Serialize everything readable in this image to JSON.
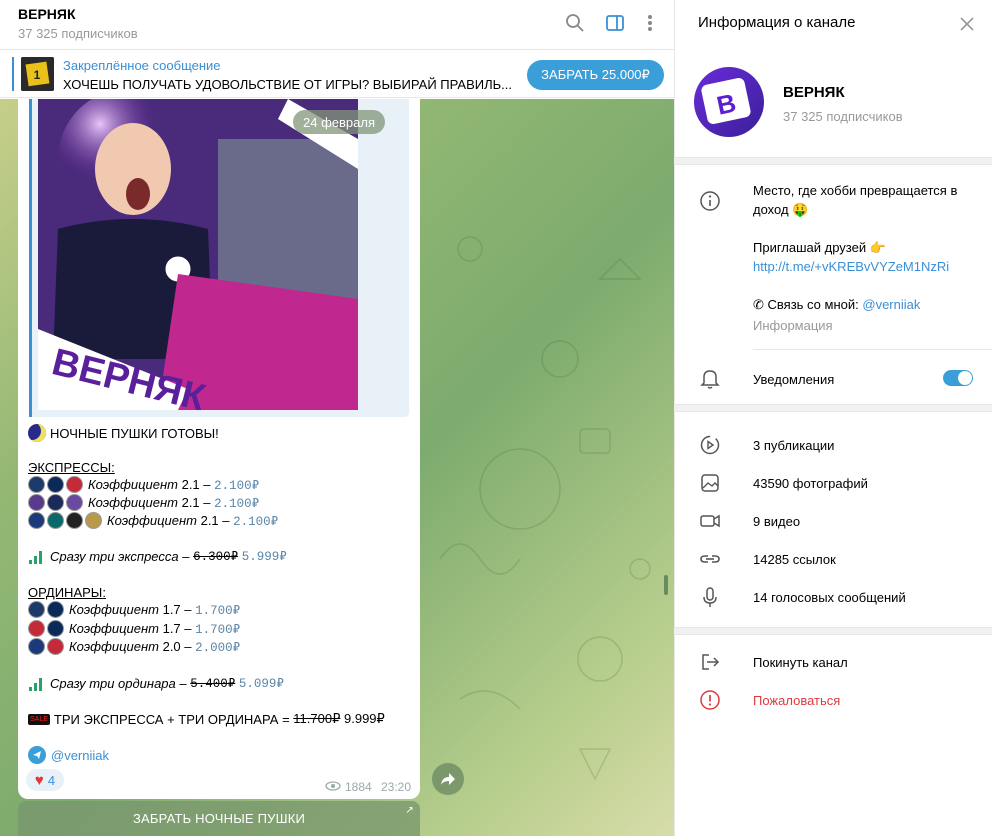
{
  "header": {
    "title": "ВЕРНЯК",
    "subscribers": "37 325 подписчиков"
  },
  "pinned": {
    "label": "Закреплённое сообщение",
    "text": "ХОЧЕШЬ ПОЛУЧАТЬ УДОВОЛЬСТВИЕ ОТ ИГРЫ? ВЫБИРАЙ ПРАВИЛЬ...",
    "button_label": "ЗАБРАТЬ 25.000₽"
  },
  "message": {
    "date_pill": "24 февраля",
    "photo_caption": "ВЕРНЯК",
    "headline": "НОЧНЫЕ ПУШКИ ГОТОВЫ!",
    "express_header": "ЭКСПРЕССЫ",
    "express_rows": [
      {
        "coef_label": "Коэффициент",
        "coef": "2.1",
        "price": "2.100₽"
      },
      {
        "coef_label": "Коэффициент",
        "coef": "2.1",
        "price": "2.100₽"
      },
      {
        "coef_label": "Коэффициент",
        "coef": "2.1",
        "price": "2.100₽"
      }
    ],
    "express_bundle": {
      "label": "Сразу три экспресса –",
      "old": "6.300₽",
      "new": "5.999₽"
    },
    "single_header": "ОРДИНАРЫ",
    "single_rows": [
      {
        "coef_label": "Коэффициент",
        "coef": "1.7",
        "price": "1.700₽"
      },
      {
        "coef_label": "Коэффициент",
        "coef": "1.7",
        "price": "1.700₽"
      },
      {
        "coef_label": "Коэффициент",
        "coef": "2.0",
        "price": "2.000₽"
      }
    ],
    "single_bundle": {
      "label": "Сразу три ординара –",
      "old": "5.400₽",
      "new": "5.099₽"
    },
    "combo": {
      "sale_badge": "SALE",
      "label": "ТРИ ЭКСПРЕССА + ТРИ ОРДИНАРА =",
      "old": "11.700₽",
      "new": "9.999₽"
    },
    "author": "@verniiak",
    "reaction_count": "4",
    "views": "1884",
    "time": "23:20",
    "bottom_button": "ЗАБРАТЬ НОЧНЫЕ ПУШКИ"
  },
  "info_panel": {
    "title": "Информация о канале",
    "channel_name": "ВЕРНЯК",
    "subscribers": "37 325 подписчиков",
    "description_line1": "Место, где хобби превращается в",
    "description_line2": "доход 🤑",
    "invite_label": "Приглашай друзей 👉",
    "invite_link": "http://t.me/+vKREBvVYZeM1NzRi",
    "contact_label": "✆ Связь со мной:",
    "contact_handle": "@verniiak",
    "info_caption": "Информация",
    "notifications_label": "Уведомления",
    "notifications_on": true,
    "stats": [
      {
        "icon": "publications-icon",
        "label": "3 публикации"
      },
      {
        "icon": "photo-icon",
        "label": "43590 фотографий"
      },
      {
        "icon": "video-icon",
        "label": "9 видео"
      },
      {
        "icon": "link-icon",
        "label": "14285 ссылок"
      },
      {
        "icon": "microphone-icon",
        "label": "14 голосовых сообщений"
      }
    ],
    "leave_label": "Покинуть канал",
    "report_label": "Пожаловаться"
  },
  "colors": {
    "accent": "#3a8fd6",
    "danger": "#e0393e",
    "chat_bg": "#8ab676"
  }
}
